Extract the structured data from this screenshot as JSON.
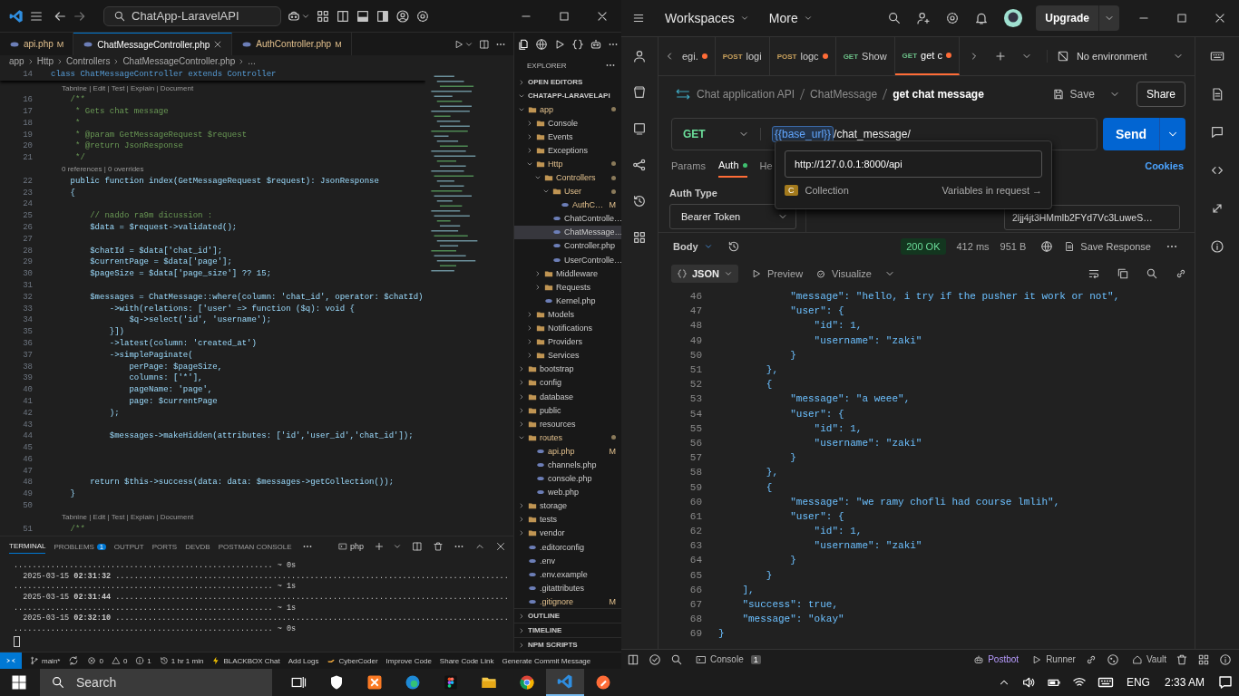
{
  "vscode": {
    "search": "ChatApp-LaravelAPI",
    "tabs": [
      {
        "label": "api.php",
        "badge": "M",
        "selected": false
      },
      {
        "label": "ChatMessageController.php",
        "selected": true
      },
      {
        "label": "AuthController.php",
        "badge": "M",
        "selected": false
      }
    ],
    "breadcrumbs": [
      "app",
      "Http",
      "Controllers",
      "ChatMessageController.php",
      "..."
    ],
    "sticky_line": {
      "number": "14",
      "text": "class ChatMessageController extends Controller"
    },
    "code_lines": [
      {
        "kind": "lens",
        "text": "Tabnine | Edit | Test | Explain | Document"
      },
      {
        "number": "16",
        "kind": "comment",
        "text": "    /**"
      },
      {
        "number": "17",
        "kind": "comment",
        "text": "     * Gets chat message"
      },
      {
        "number": "18",
        "kind": "comment",
        "text": "     *"
      },
      {
        "number": "19",
        "kind": "comment",
        "text": "     * @param GetMessageRequest $request"
      },
      {
        "number": "20",
        "kind": "comment",
        "text": "     * @return JsonResponse"
      },
      {
        "number": "21",
        "kind": "comment",
        "text": "     */"
      },
      {
        "kind": "lens",
        "text": "0 references | 0 overrides"
      },
      {
        "number": "22",
        "kind": "code",
        "text": "    public function index(GetMessageRequest $request): JsonResponse"
      },
      {
        "number": "23",
        "kind": "code",
        "text": "    {"
      },
      {
        "number": "24",
        "kind": "code"
      },
      {
        "number": "25",
        "kind": "comment",
        "text": "        // naddo ra9m dicussion :"
      },
      {
        "number": "26",
        "kind": "code",
        "text": "        $data = $request->validated();"
      },
      {
        "number": "27",
        "kind": "code"
      },
      {
        "number": "28",
        "kind": "code",
        "text": "        $chatId = $data['chat_id'];"
      },
      {
        "number": "29",
        "kind": "code",
        "text": "        $currentPage = $data['page'];"
      },
      {
        "number": "30",
        "kind": "code",
        "text": "        $pageSize = $data['page_size'] ?? 15;"
      },
      {
        "number": "31",
        "kind": "code"
      },
      {
        "number": "32",
        "kind": "code",
        "text": "        $messages = ChatMessage::where(column: 'chat_id', operator: $chatId)"
      },
      {
        "number": "33",
        "kind": "code",
        "text": "            ->with(relations: ['user' => function ($q): void {"
      },
      {
        "number": "34",
        "kind": "code",
        "text": "                $q->select('id', 'username');"
      },
      {
        "number": "35",
        "kind": "code",
        "text": "            }])"
      },
      {
        "number": "36",
        "kind": "code",
        "text": "            ->latest(column: 'created_at')"
      },
      {
        "number": "37",
        "kind": "code",
        "text": "            ->simplePaginate("
      },
      {
        "number": "38",
        "kind": "code",
        "text": "                perPage: $pageSize,"
      },
      {
        "number": "39",
        "kind": "code",
        "text": "                columns: ['*'],"
      },
      {
        "number": "40",
        "kind": "code",
        "text": "                pageName: 'page',"
      },
      {
        "number": "41",
        "kind": "code",
        "text": "                page: $currentPage"
      },
      {
        "number": "42",
        "kind": "code",
        "text": "            );"
      },
      {
        "number": "43",
        "kind": "code"
      },
      {
        "number": "44",
        "kind": "code",
        "text": "            $messages->makeHidden(attributes: ['id','user_id','chat_id']);"
      },
      {
        "number": "45",
        "kind": "code"
      },
      {
        "number": "46",
        "kind": "code"
      },
      {
        "number": "47",
        "kind": "code"
      },
      {
        "number": "48",
        "kind": "code",
        "text": "        return $this->success(data: data: $messages->getCollection());"
      },
      {
        "number": "49",
        "kind": "code",
        "text": "    }"
      },
      {
        "number": "50",
        "kind": "code"
      },
      {
        "kind": "lens",
        "text": "Tabnine | Edit | Test | Explain | Document"
      },
      {
        "number": "51",
        "kind": "comment",
        "text": "    /**"
      }
    ],
    "explorer": {
      "title": "EXPLORER",
      "top_sections": [
        {
          "label": "OPEN EDITORS",
          "expanded": false
        },
        {
          "label": "CHATAPP-LARAVELAPI",
          "expanded": true
        }
      ],
      "tree": [
        {
          "label": "app",
          "kind": "folder",
          "expanded": true,
          "modified": true,
          "selected": false,
          "children": [
            {
              "label": "Console",
              "kind": "folder",
              "expanded": false,
              "modified": false,
              "selected": false
            },
            {
              "label": "Events",
              "kind": "folder",
              "expanded": false,
              "modified": false,
              "selected": false
            },
            {
              "label": "Exceptions",
              "kind": "folder",
              "expanded": false,
              "modified": false,
              "selected": false
            },
            {
              "label": "Http",
              "kind": "folder",
              "expanded": true,
              "modified": true,
              "selected": false,
              "children": [
                {
                  "label": "Controllers",
                  "kind": "folder",
                  "expanded": true,
                  "modified": true,
                  "selected": false,
                  "children": [
                    {
                      "label": "User",
                      "kind": "folder",
                      "expanded": true,
                      "modified": true,
                      "selected": false,
                      "children": [
                        {
                          "label": "AuthC…",
                          "kind": "file",
                          "modified": true,
                          "badge": "M",
                          "selected": false
                        }
                      ]
                    },
                    {
                      "label": "ChatControlle…",
                      "kind": "file",
                      "modified": false,
                      "selected": false
                    },
                    {
                      "label": "ChatMessage…",
                      "kind": "file",
                      "modified": false,
                      "selected": true
                    },
                    {
                      "label": "Controller.php",
                      "kind": "file",
                      "modified": false,
                      "selected": false
                    },
                    {
                      "label": "UserControlle…",
                      "kind": "file",
                      "modified": false,
                      "selected": false
                    }
                  ]
                },
                {
                  "label": "Middleware",
                  "kind": "folder",
                  "expanded": false,
                  "modified": false,
                  "selected": false
                },
                {
                  "label": "Requests",
                  "kind": "folder",
                  "expanded": false,
                  "modified": false,
                  "selected": false
                },
                {
                  "label": "Kernel.php",
                  "kind": "file",
                  "modified": false,
                  "selected": false
                }
              ]
            },
            {
              "label": "Models",
              "kind": "folder",
              "expanded": false,
              "modified": false,
              "selected": false
            },
            {
              "label": "Notifications",
              "kind": "folder",
              "expanded": false,
              "modified": false,
              "selected": false
            },
            {
              "label": "Providers",
              "kind": "folder",
              "expanded": false,
              "modified": false,
              "selected": false
            },
            {
              "label": "Services",
              "kind": "folder",
              "expanded": false,
              "modified": false,
              "selected": false
            }
          ]
        },
        {
          "label": "bootstrap",
          "kind": "folder",
          "expanded": false,
          "modified": false,
          "selected": false
        },
        {
          "label": "config",
          "kind": "folder",
          "expanded": false,
          "modified": false,
          "selected": false
        },
        {
          "label": "database",
          "kind": "folder",
          "expanded": false,
          "modified": false,
          "selected": false
        },
        {
          "label": "public",
          "kind": "folder",
          "expanded": false,
          "modified": false,
          "selected": false
        },
        {
          "label": "resources",
          "kind": "folder",
          "expanded": false,
          "modified": false,
          "selected": false
        },
        {
          "label": "routes",
          "kind": "folder",
          "expanded": true,
          "modified": true,
          "selected": false,
          "children": [
            {
              "label": "api.php",
              "kind": "file",
              "modified": true,
              "badge": "M",
              "selected": false
            },
            {
              "label": "channels.php",
              "kind": "file",
              "modified": false,
              "selected": false
            },
            {
              "label": "console.php",
              "kind": "file",
              "modified": false,
              "selected": false
            },
            {
              "label": "web.php",
              "kind": "file",
              "modified": false,
              "selected": false
            }
          ]
        },
        {
          "label": "storage",
          "kind": "folder",
          "expanded": false,
          "modified": false,
          "selected": false
        },
        {
          "label": "tests",
          "kind": "folder",
          "expanded": false,
          "modified": false,
          "selected": false
        },
        {
          "label": "vendor",
          "kind": "folder",
          "expanded": false,
          "modified": false,
          "selected": false
        },
        {
          "label": ".editorconfig",
          "kind": "file",
          "modified": false,
          "selected": false
        },
        {
          "label": ".env",
          "kind": "file",
          "modified": false,
          "selected": false
        },
        {
          "label": ".env.example",
          "kind": "file",
          "modified": false,
          "selected": false
        },
        {
          "label": ".gitattributes",
          "kind": "file",
          "modified": false,
          "selected": false
        },
        {
          "label": ".gitignore",
          "kind": "file",
          "modified": true,
          "badge": "M",
          "selected": false
        }
      ],
      "bottom_sections": [
        {
          "label": "OUTLINE",
          "expanded": false
        },
        {
          "label": "TIMELINE",
          "expanded": false
        },
        {
          "label": "NPM SCRIPTS",
          "expanded": false
        }
      ]
    },
    "panel": {
      "tabs": [
        {
          "label": "TERMINAL",
          "selected": true
        },
        {
          "label": "PROBLEMS",
          "badge": "1",
          "selected": false
        },
        {
          "label": "OUTPUT",
          "selected": false
        },
        {
          "label": "PORTS",
          "selected": false
        },
        {
          "label": "DEVDB",
          "selected": false
        },
        {
          "label": "POSTMAN CONSOLE",
          "selected": false
        }
      ],
      "shell": "php",
      "lines": [
        "........................................................ ~ 0s",
        "  2025-03-15 **02:31:32** .....................................................................................",
        "........................................................ ~ 1s",
        "  2025-03-15 **02:31:44** .....................................................................................",
        "........................................................ ~ 1s",
        "  2025-03-15 **02:32:10** .....................................................................................",
        "........................................................ ~ 0s"
      ]
    },
    "status_bar": [
      {
        "kind": "remote"
      },
      {
        "kind": "branch",
        "text": "main*"
      },
      {
        "kind": "sync"
      },
      {
        "kind": "error",
        "text": "0"
      },
      {
        "kind": "warning",
        "text": "0"
      },
      {
        "kind": "info",
        "text": "1"
      },
      {
        "kind": "clock",
        "text": "1 hr 1 min"
      },
      {
        "kind": "bolt",
        "text": "BLACKBOX Chat"
      },
      {
        "kind": "plain",
        "text": "Add Logs"
      },
      {
        "kind": "hand",
        "text": "CyberCoder"
      },
      {
        "kind": "plain",
        "text": "Improve Code"
      },
      {
        "kind": "plain",
        "text": "Share Code Link"
      },
      {
        "kind": "plain",
        "text": "Generate Commit Message"
      }
    ]
  },
  "postman": {
    "top": {
      "workspaces": "Workspaces",
      "more": "More",
      "upgrade": "Upgrade"
    },
    "tabs": [
      {
        "name": "egi.",
        "unsaved": true,
        "selected": false
      },
      {
        "method": "POST",
        "color": "#c9a15c",
        "name": "logi",
        "unsaved": false,
        "selected": false
      },
      {
        "method": "POST",
        "color": "#c9a15c",
        "name": "logc",
        "unsaved": true,
        "selected": false
      },
      {
        "method": "GET",
        "color": "#6bbf87",
        "name": "Show",
        "unsaved": false,
        "selected": false
      },
      {
        "method": "GET",
        "color": "#6bbf87",
        "name": "get c",
        "unsaved": true,
        "selected": true
      }
    ],
    "environment": "No environment",
    "breadcrumb": [
      "Chat application API",
      "ChatMessage",
      "get chat message"
    ],
    "save": "Save",
    "share": "Share",
    "request": {
      "method": "GET",
      "url_variable": "{{base_url}}",
      "url_path": "/chat_message/",
      "send": "Send"
    },
    "request_tabs": [
      {
        "label": "Params",
        "dot": false,
        "selected": false
      },
      {
        "label": "Auth",
        "dot": true,
        "selected": true
      },
      {
        "label": "He",
        "dot": false,
        "selected": false
      }
    ],
    "cookies": "Cookies",
    "auth": {
      "label": "Auth Type",
      "type": "Bearer Token",
      "token": "2ljj4jt3HMmlb2FYd7Vc3LuweS…"
    },
    "variable_popup": {
      "value": "http://127.0.0.1:8000/api",
      "scope_badge": "C",
      "scope": "Collection",
      "link": "Variables in request →"
    },
    "response": {
      "body": "Body",
      "status": "200 OK",
      "time": "412 ms",
      "size": "951 B",
      "save": "Save Response",
      "format": "JSON",
      "preview": "Preview",
      "visualize": "Visualize",
      "lines": [
        {
          "number": "46",
          "text": "            \"message\": \"hello, i try if the pusher it work or not\","
        },
        {
          "number": "47",
          "text": "            \"user\": {"
        },
        {
          "number": "48",
          "text": "                \"id\": 1,"
        },
        {
          "number": "49",
          "text": "                \"username\": \"zaki\""
        },
        {
          "number": "50",
          "text": "            }"
        },
        {
          "number": "51",
          "text": "        },"
        },
        {
          "number": "52",
          "text": "        {"
        },
        {
          "number": "53",
          "text": "            \"message\": \"a weee\","
        },
        {
          "number": "54",
          "text": "            \"user\": {"
        },
        {
          "number": "55",
          "text": "                \"id\": 1,"
        },
        {
          "number": "56",
          "text": "                \"username\": \"zaki\""
        },
        {
          "number": "57",
          "text": "            }"
        },
        {
          "number": "58",
          "text": "        },"
        },
        {
          "number": "59",
          "text": "        {"
        },
        {
          "number": "60",
          "text": "            \"message\": \"we ramy chofli had course lmlih\","
        },
        {
          "number": "61",
          "text": "            \"user\": {"
        },
        {
          "number": "62",
          "text": "                \"id\": 1,"
        },
        {
          "number": "63",
          "text": "                \"username\": \"zaki\""
        },
        {
          "number": "64",
          "text": "            }"
        },
        {
          "number": "65",
          "text": "        }"
        },
        {
          "number": "66",
          "text": "    ],"
        },
        {
          "number": "67",
          "text": "    \"success\": true,"
        },
        {
          "number": "68",
          "text": "    \"message\": \"okay\""
        },
        {
          "number": "69",
          "text": "}"
        }
      ]
    },
    "bottom": {
      "console": "Console",
      "console_badge": "1",
      "postbot": "Postbot",
      "runner": "Runner",
      "vault": "Vault"
    }
  },
  "taskbar": {
    "search": "Search",
    "apps": [
      {
        "kind": "task-view",
        "selected": false
      },
      {
        "kind": "shield",
        "selected": false
      },
      {
        "kind": "xampp",
        "selected": false
      },
      {
        "kind": "edge",
        "selected": false
      },
      {
        "kind": "figma",
        "selected": false
      },
      {
        "kind": "folder",
        "selected": false
      },
      {
        "kind": "chrome",
        "selected": false
      },
      {
        "kind": "vscode",
        "selected": true
      },
      {
        "kind": "postman",
        "selected": false
      }
    ],
    "language": "ENG",
    "time": "2:33 AM"
  }
}
